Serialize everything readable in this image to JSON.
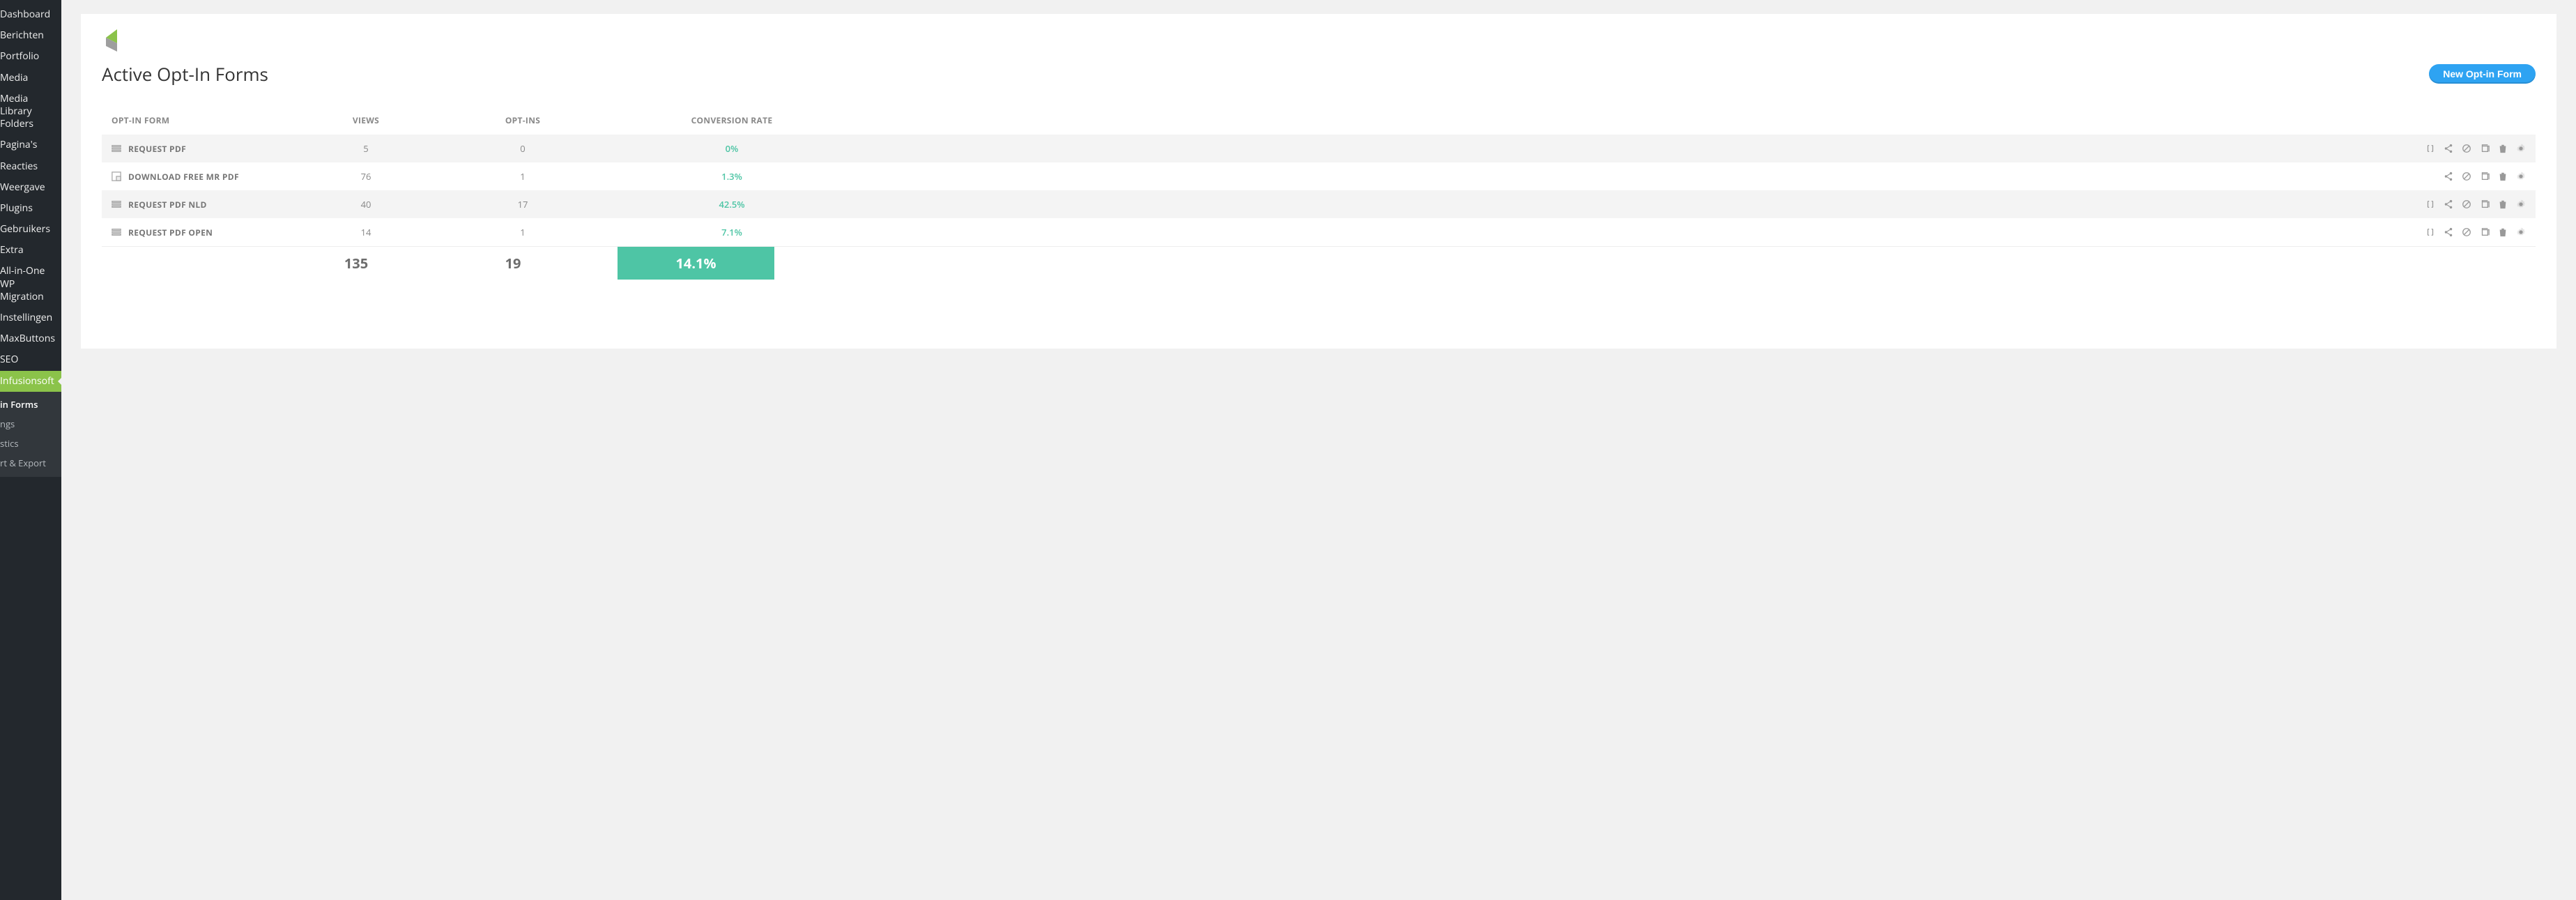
{
  "sidebar": {
    "items": [
      {
        "label": "Dashboard"
      },
      {
        "label": "Berichten"
      },
      {
        "label": "Portfolio"
      },
      {
        "label": "Media"
      },
      {
        "label": "Media Library Folders"
      },
      {
        "label": "Pagina's"
      },
      {
        "label": "Reacties"
      },
      {
        "label": "Weergave"
      },
      {
        "label": "Plugins"
      },
      {
        "label": "Gebruikers"
      },
      {
        "label": "Extra"
      },
      {
        "label": "All-in-One WP Migration"
      },
      {
        "label": "Instellingen"
      },
      {
        "label": "MaxButtons"
      },
      {
        "label": "SEO"
      },
      {
        "label": "Infusionsoft",
        "active": true
      }
    ],
    "sub_items": [
      {
        "label": "in Forms",
        "bold": true
      },
      {
        "label": "ngs"
      },
      {
        "label": "stics"
      },
      {
        "label": "rt & Export"
      }
    ]
  },
  "page": {
    "title": "Active Opt-In Forms",
    "new_button": "New Opt-in Form"
  },
  "table": {
    "headers": {
      "form": "OPT-IN FORM",
      "views": "VIEWS",
      "optins": "OPT-INS",
      "conv": "CONVERSION RATE"
    },
    "rows": [
      {
        "type": "popup",
        "name": "REQUEST PDF",
        "views": "5",
        "optins": "0",
        "conv": "0%",
        "actions": [
          "code",
          "share",
          "disable",
          "dup",
          "delete",
          "settings"
        ]
      },
      {
        "type": "flyin",
        "name": "DOWNLOAD FREE MR PDF",
        "views": "76",
        "optins": "1",
        "conv": "1.3%",
        "actions": [
          "share",
          "disable",
          "dup",
          "delete",
          "settings"
        ]
      },
      {
        "type": "popup",
        "name": "REQUEST PDF NLD",
        "views": "40",
        "optins": "17",
        "conv": "42.5%",
        "actions": [
          "code",
          "share",
          "disable",
          "dup",
          "delete",
          "settings"
        ]
      },
      {
        "type": "popup",
        "name": "REQUEST PDF OPEN",
        "views": "14",
        "optins": "1",
        "conv": "7.1%",
        "actions": [
          "code",
          "share",
          "disable",
          "dup",
          "delete",
          "settings"
        ]
      }
    ],
    "totals": {
      "views": "135",
      "optins": "19",
      "conv": "14.1%"
    }
  }
}
